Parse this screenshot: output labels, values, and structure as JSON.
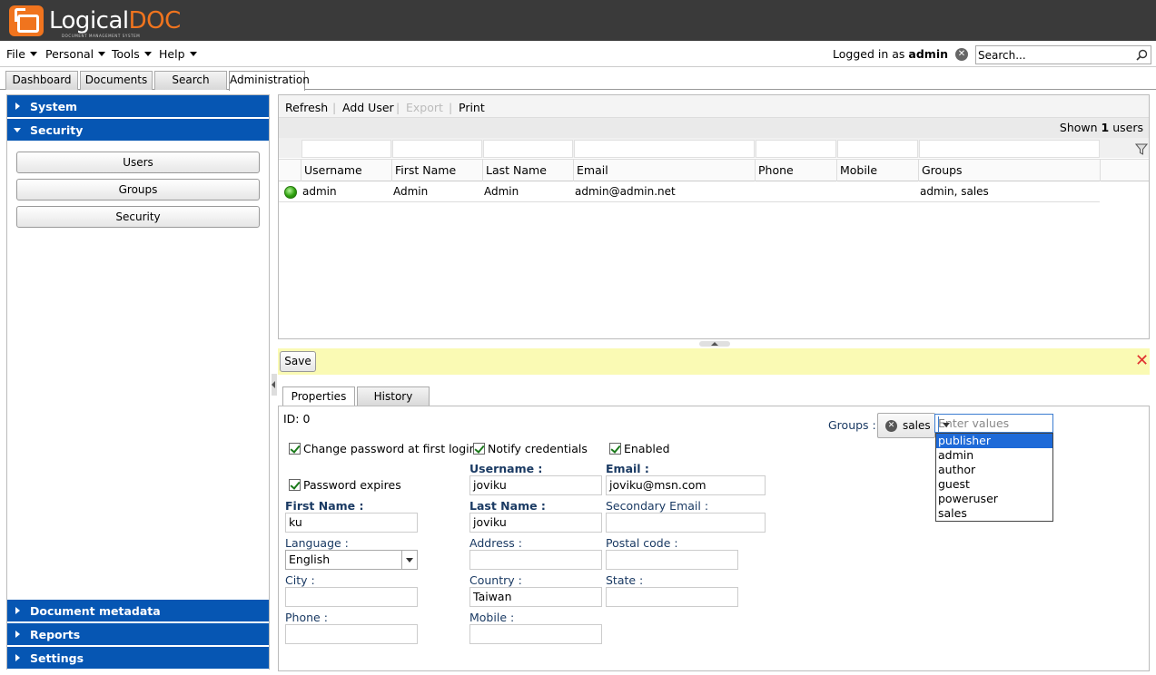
{
  "app": {
    "name_a": "Logical",
    "name_b": "DOC",
    "subtitle": "DOCUMENT MANAGEMENT SYSTEM"
  },
  "menu": [
    {
      "label": "File"
    },
    {
      "label": "Personal"
    },
    {
      "label": "Tools"
    },
    {
      "label": "Help"
    }
  ],
  "session": {
    "prefix": "Logged in as",
    "user": "admin",
    "logout_icon": "close-circle-icon"
  },
  "search": {
    "placeholder": "Search..."
  },
  "tabs": [
    {
      "label": "Dashboard"
    },
    {
      "label": "Documents"
    },
    {
      "label": "Search"
    },
    {
      "label": "Administration"
    }
  ],
  "sidebar": {
    "system": "System",
    "security": "Security",
    "buttons": [
      "Users",
      "Groups",
      "Security"
    ],
    "document_metadata": "Document metadata",
    "reports": "Reports",
    "settings": "Settings"
  },
  "toolbar": {
    "refresh": "Refresh",
    "add_user": "Add User",
    "export": "Export",
    "print": "Print",
    "sep": "|"
  },
  "shown": {
    "prefix": "Shown",
    "count": "1",
    "suffix": "users"
  },
  "grid": {
    "columns": [
      "Username",
      "First Name",
      "Last Name",
      "Email",
      "Phone",
      "Mobile",
      "Groups"
    ],
    "rows": [
      {
        "username": "admin",
        "first_name": "Admin",
        "last_name": "Admin",
        "email": "admin@admin.net",
        "phone": "",
        "mobile": "",
        "groups": "admin, sales"
      }
    ]
  },
  "savebar": {
    "save": "Save"
  },
  "detail_tabs": [
    {
      "label": "Properties"
    },
    {
      "label": "History"
    }
  ],
  "form": {
    "id_label": "ID: 0",
    "change_pw": "Change password at first login",
    "notify": "Notify credentials",
    "enabled": "Enabled",
    "pw_expires": "Password expires",
    "username_label": "Username :",
    "username": "joviku",
    "email_label": "Email :",
    "email": "joviku@msn.com",
    "first_name_label": "First Name :",
    "first_name": "ku",
    "last_name_label": "Last Name :",
    "last_name": "joviku",
    "secondary_email_label": "Secondary Email :",
    "secondary_email": "",
    "language_label": "Language :",
    "language": "English",
    "address_label": "Address :",
    "address": "",
    "postal_label": "Postal code :",
    "postal": "",
    "city_label": "City :",
    "city": "",
    "country_label": "Country :",
    "country": "Taiwan",
    "state_label": "State :",
    "state": "",
    "phone_label": "Phone :",
    "phone": "",
    "mobile_label": "Mobile :",
    "mobile": "",
    "groups_label": "Groups :",
    "group_chip": "sales",
    "groups_placeholder": "Enter values",
    "group_options": [
      "publisher",
      "admin",
      "author",
      "guest",
      "poweruser",
      "sales"
    ]
  }
}
